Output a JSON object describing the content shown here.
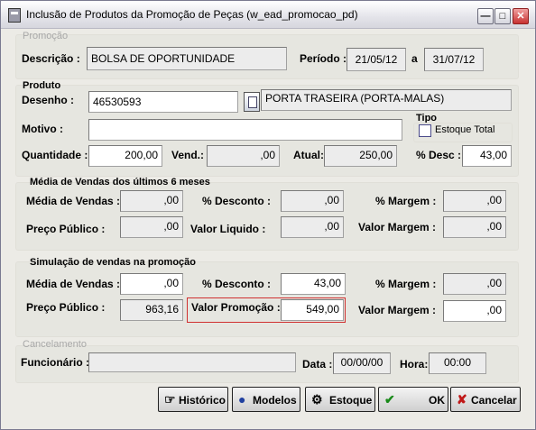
{
  "window": {
    "title": "Inclusão de Produtos da Promoção de Peças (w_ead_promocao_pd)"
  },
  "promocao": {
    "group_title": "Promoção",
    "descricao_label": "Descrição :",
    "descricao_value": "BOLSA DE OPORTUNIDADE",
    "periodo_label": "Período :",
    "periodo_start": "21/05/12",
    "periodo_sep": "a",
    "periodo_end": "31/07/12"
  },
  "produto": {
    "group_title": "Produto",
    "desenho_label": "Desenho :",
    "desenho_value": "46530593",
    "desenho_desc": "PORTA TRASEIRA (PORTA-MALAS)",
    "motivo_label": "Motivo :",
    "motivo_value": "",
    "tipo_label": "Tipo",
    "estoque_total_label": "Estoque Total",
    "estoque_total_checked": false,
    "quantidade_label": "Quantidade :",
    "quantidade_value": "200,00",
    "vend_label": "Vend.:",
    "vend_value": ",00",
    "atual_label": "Atual:",
    "atual_value": "250,00",
    "pct_desc_label": "% Desc :",
    "pct_desc_value": "43,00"
  },
  "media_vendas": {
    "group_title": "Média de Vendas dos últimos 6 meses",
    "media_label": "Média de Vendas :",
    "media_value": ",00",
    "pct_desconto_label": "% Desconto :",
    "pct_desconto_value": ",00",
    "pct_margem_label": "% Margem :",
    "pct_margem_value": ",00",
    "preco_publico_label": "Preço Público :",
    "preco_publico_value": ",00",
    "valor_liquido_label": "Valor Liquido :",
    "valor_liquido_value": ",00",
    "valor_margem_label": "Valor Margem :",
    "valor_margem_value": ",00"
  },
  "simulacao": {
    "group_title": "Simulação de vendas na promoção",
    "media_label": "Média de Vendas :",
    "media_value": ",00",
    "pct_desconto_label": "% Desconto :",
    "pct_desconto_value": "43,00",
    "pct_margem_label": "% Margem :",
    "pct_margem_value": ",00",
    "preco_publico_label": "Preço Público :",
    "preco_publico_value": "963,16",
    "valor_promocao_label": "Valor Promoção :",
    "valor_promocao_value": "549,00",
    "valor_margem_label": "Valor Margem :",
    "valor_margem_value": ",00"
  },
  "cancelamento": {
    "group_title": "Cancelamento",
    "funcionario_label": "Funcionário :",
    "funcionario_value": "",
    "data_label": "Data :",
    "data_value": "00/00/00",
    "hora_label": "Hora:",
    "hora_value": "00:00"
  },
  "buttons": {
    "historico": "Histórico",
    "modelos": "Modelos",
    "estoque": "Estoque",
    "ok": "OK",
    "cancelar": "Cancelar"
  }
}
